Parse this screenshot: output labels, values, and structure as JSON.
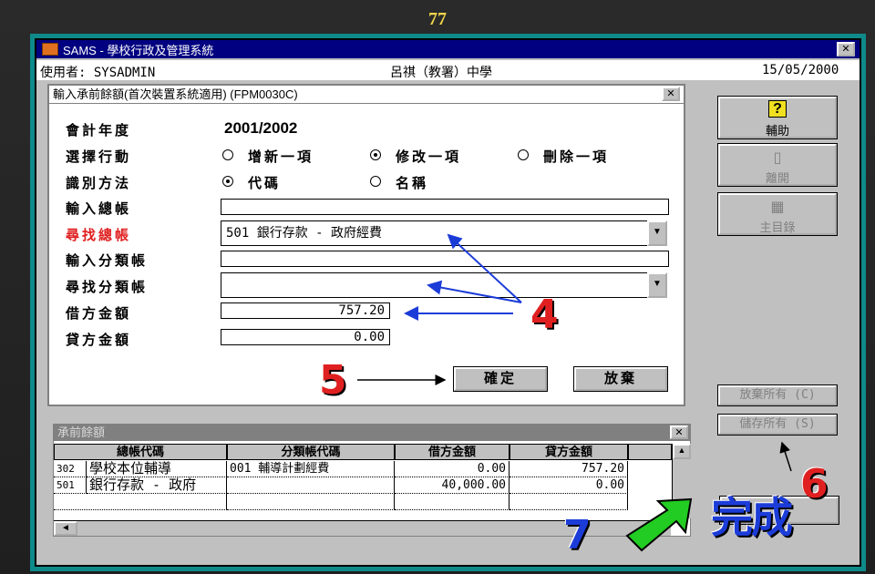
{
  "slide_number": "77",
  "window": {
    "title": "SAMS - 學校行政及管理系統",
    "user_label": "使用者: SYSADMIN",
    "school": "呂祺（教署）中學",
    "date": "15/05/2000"
  },
  "dialog": {
    "title": "輸入承前餘額(首次裝置系統適用) (FPM0030C)",
    "labels": {
      "fiscal_year": "會計年度",
      "action": "選擇行動",
      "identify": "識別方法",
      "input_gl": "輸入總帳",
      "find_gl": "尋找總帳",
      "input_sub": "輸入分類帳",
      "find_sub": "尋找分類帳",
      "debit": "借方金額",
      "credit": "貸方金額"
    },
    "fiscal_year_value": "2001/2002",
    "action_options": [
      "增新一項",
      "修改一項",
      "刪除一項"
    ],
    "action_selected": "修改一項",
    "identify_options": [
      "代碼",
      "名稱"
    ],
    "identify_selected": "代碼",
    "find_gl_value": "501 銀行存款 - 政府經費",
    "debit_value": "757.20",
    "credit_value": "0.00",
    "confirm_label": "確定",
    "cancel_label": "放棄"
  },
  "side_buttons": {
    "help": "輔助",
    "exit": "離開",
    "main_menu": "主目錄",
    "discard_all": "放棄所有 (C)",
    "save_all": "儲存所有 (S)"
  },
  "grid": {
    "title": "承前餘額",
    "columns": [
      "總帳代碼",
      "分類帳代碼",
      "借方金額",
      "貸方金額"
    ],
    "rows": [
      {
        "code": "302",
        "gl": "學校本位輔導",
        "sub": "001 輔導計劃經費",
        "debit": "0.00",
        "credit": "757.20"
      },
      {
        "code": "501",
        "gl": "銀行存款 - 政府",
        "sub": "",
        "debit": "40,000.00",
        "credit": "0.00"
      }
    ]
  },
  "annotations": {
    "n4": "4",
    "n5": "5",
    "n6": "6",
    "n7": "7",
    "done": "完成"
  },
  "colors": {
    "title_bar": "#000080",
    "frame": "#0e8a8a",
    "annotation_blue": "#1c3cd8",
    "annotation_red": "#e02020",
    "arrow_green": "#22cc22"
  }
}
